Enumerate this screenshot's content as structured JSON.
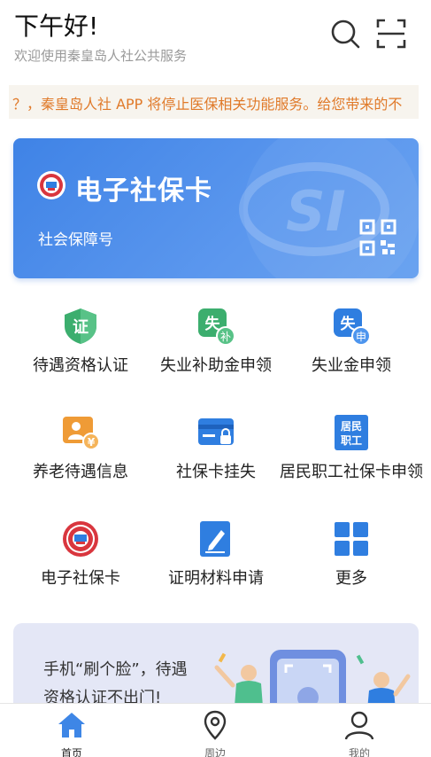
{
  "header": {
    "greeting": "下午好!",
    "subtitle": "欢迎使用秦皇岛人社公共服务",
    "search_icon": "search-icon",
    "scan_icon": "scan-icon"
  },
  "notice": {
    "text": "？，秦皇岛人社 APP 将停止医保相关功能服务。给您带来的不"
  },
  "card": {
    "title": "电子社保卡",
    "number_label": "社会保障号",
    "watermark_text": "SI",
    "accent": "#4a8ae8"
  },
  "services": [
    {
      "label": "待遇资格认证",
      "icon": "shield-verify-icon",
      "glyph": "证",
      "color": "#3cae6e"
    },
    {
      "label": "失业补助金申领",
      "icon": "unemployment-subsidy-icon",
      "glyph": "失",
      "sub": "补",
      "color": "#3cae6e"
    },
    {
      "label": "失业金申领",
      "icon": "unemployment-benefit-icon",
      "glyph": "失",
      "sub": "申",
      "color": "#2f7ee0"
    },
    {
      "label": "养老待遇信息",
      "icon": "pension-info-icon",
      "glyph": "¥",
      "color": "#ef9b36"
    },
    {
      "label": "社保卡挂失",
      "icon": "card-lock-icon",
      "color": "#2f7ee0"
    },
    {
      "label": "居民职工社保卡申领",
      "icon": "resident-card-icon",
      "glyph": "居民职工",
      "color": "#2f7ee0"
    },
    {
      "label": "电子社保卡",
      "icon": "e-card-emblem-icon",
      "color": "#d9363e"
    },
    {
      "label": "证明材料申请",
      "icon": "document-edit-icon",
      "color": "#2f7ee0"
    },
    {
      "label": "更多",
      "icon": "more-grid-icon",
      "color": "#2f7ee0"
    }
  ],
  "banner": {
    "line1": "手机“刷个脸”，待遇",
    "line2": "资格认证不出门!"
  },
  "nav": [
    {
      "label": "首页",
      "icon": "home-icon"
    },
    {
      "label": "周边",
      "icon": "location-pin-icon"
    },
    {
      "label": "我的",
      "icon": "user-icon"
    }
  ]
}
